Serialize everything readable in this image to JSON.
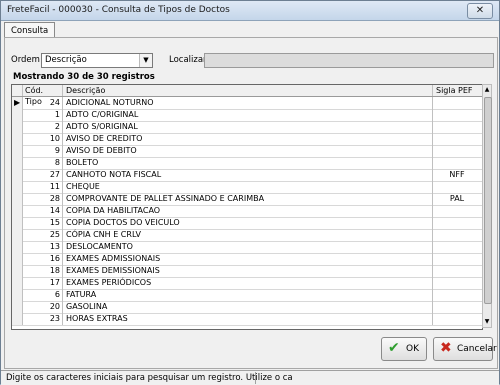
{
  "window": {
    "title": "FreteFacil - 000030 - Consulta de Tipos de Doctos",
    "close_glyph": "✕"
  },
  "tabs": [
    {
      "label": "Consulta"
    }
  ],
  "filters": {
    "ordem_label": "Ordem",
    "ordem_value": "Descrição",
    "localizar_label": "Localizar",
    "localizar_value": ""
  },
  "records_caption": "Mostrando 30 de 30 registros",
  "table": {
    "columns": [
      "Cód. Tipo",
      "Descrição",
      "Sigla PEF"
    ],
    "rows": [
      {
        "code": "24",
        "desc": "ADICIONAL NOTURNO",
        "sigla": ""
      },
      {
        "code": "1",
        "desc": "ADTO C/ORIGINAL",
        "sigla": ""
      },
      {
        "code": "2",
        "desc": "ADTO S/ORIGINAL",
        "sigla": ""
      },
      {
        "code": "10",
        "desc": "AVISO DE CREDITO",
        "sigla": ""
      },
      {
        "code": "9",
        "desc": "AVISO DE DEBITO",
        "sigla": ""
      },
      {
        "code": "8",
        "desc": "BOLETO",
        "sigla": ""
      },
      {
        "code": "27",
        "desc": "CANHOTO NOTA FISCAL",
        "sigla": "NFF"
      },
      {
        "code": "11",
        "desc": "CHEQUE",
        "sigla": ""
      },
      {
        "code": "28",
        "desc": "COMPROVANTE DE PALLET ASSINADO E CARIMBA",
        "sigla": "PAL"
      },
      {
        "code": "14",
        "desc": "COPIA DA HABILITACAO",
        "sigla": ""
      },
      {
        "code": "15",
        "desc": "COPIA DOCTOS DO VEICULO",
        "sigla": ""
      },
      {
        "code": "25",
        "desc": "CÓPIA CNH E CRLV",
        "sigla": ""
      },
      {
        "code": "13",
        "desc": "DESLOCAMENTO",
        "sigla": ""
      },
      {
        "code": "16",
        "desc": "EXAMES ADMISSIONAIS",
        "sigla": ""
      },
      {
        "code": "18",
        "desc": "EXAMES DEMISSIONAIS",
        "sigla": ""
      },
      {
        "code": "17",
        "desc": "EXAMES PERIÓDICOS",
        "sigla": ""
      },
      {
        "code": "6",
        "desc": "FATURA",
        "sigla": ""
      },
      {
        "code": "20",
        "desc": "GASOLINA",
        "sigla": ""
      },
      {
        "code": "23",
        "desc": "HORAS EXTRAS",
        "sigla": ""
      }
    ]
  },
  "buttons": {
    "ok_label": "OK",
    "cancel_label": "Cancelar"
  },
  "status_bar": {
    "hint": "Digite os caracteres iniciais para pesquisar um registro. Utilize o ca"
  },
  "colors": {
    "ok_check": "#2e9e2e",
    "cancel_x": "#c8281e",
    "selected_arrow": "#000000"
  }
}
